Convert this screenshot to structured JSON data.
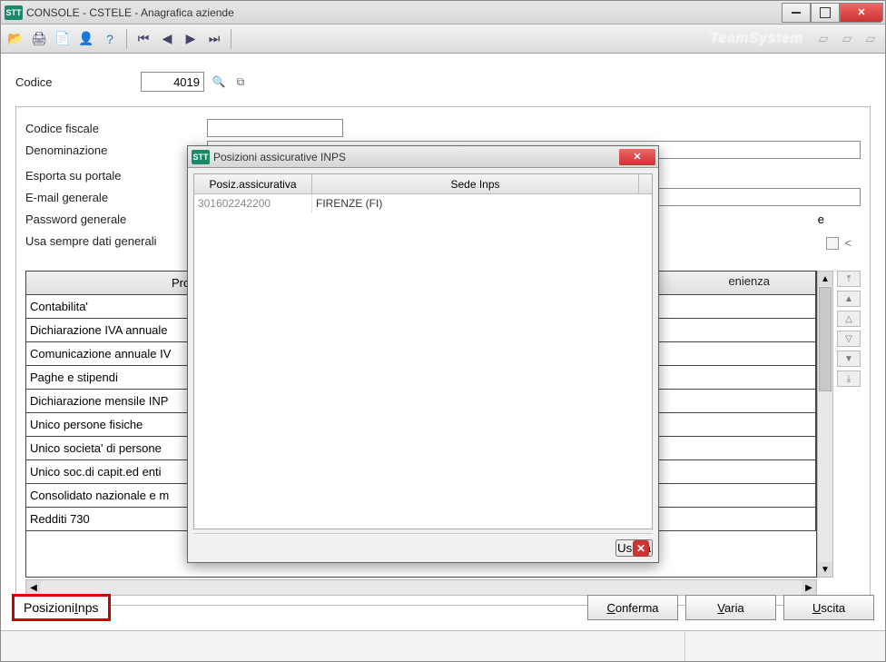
{
  "window": {
    "app_icon": "STT",
    "title": "CONSOLE - CSTELE -  Anagrafica aziende"
  },
  "toolbar": {
    "brand": "TeamSystem"
  },
  "codice": {
    "label": "Codice",
    "value": "4019"
  },
  "form": {
    "codice_fiscale_label": "Codice fiscale",
    "denominazione_label": "Denominazione",
    "esporta_label": "Esporta su portale",
    "email_label": "E-mail generale",
    "password_label": "Password generale",
    "usa_sempre_label": "Usa sempre dati generali",
    "right_partial_label": "e",
    "check_symbol": "<"
  },
  "proc_table": {
    "header_left": "Proced",
    "header_right": "enienza",
    "rows": [
      "Contabilita'",
      "Dichiarazione IVA annuale",
      "Comunicazione annuale IV",
      "Paghe e stipendi",
      "Dichiarazione mensile INP",
      "Unico persone fisiche",
      "Unico societa' di persone",
      "Unico soc.di capit.ed enti",
      "Consolidato nazionale e m",
      "Redditi 730"
    ]
  },
  "bottom": {
    "posizioni_inps": "PosizioniInps",
    "conferma": "Conferma",
    "varia": "Varia",
    "uscita": "Uscita"
  },
  "modal": {
    "app_icon": "STT",
    "title": "Posizioni assicurative INPS",
    "col_pos": "Posiz.assicurativa",
    "col_sede": "Sede Inps",
    "row": {
      "pos": "301602242200",
      "sede": "FIRENZE (FI)"
    },
    "uscita": "Uscita"
  }
}
